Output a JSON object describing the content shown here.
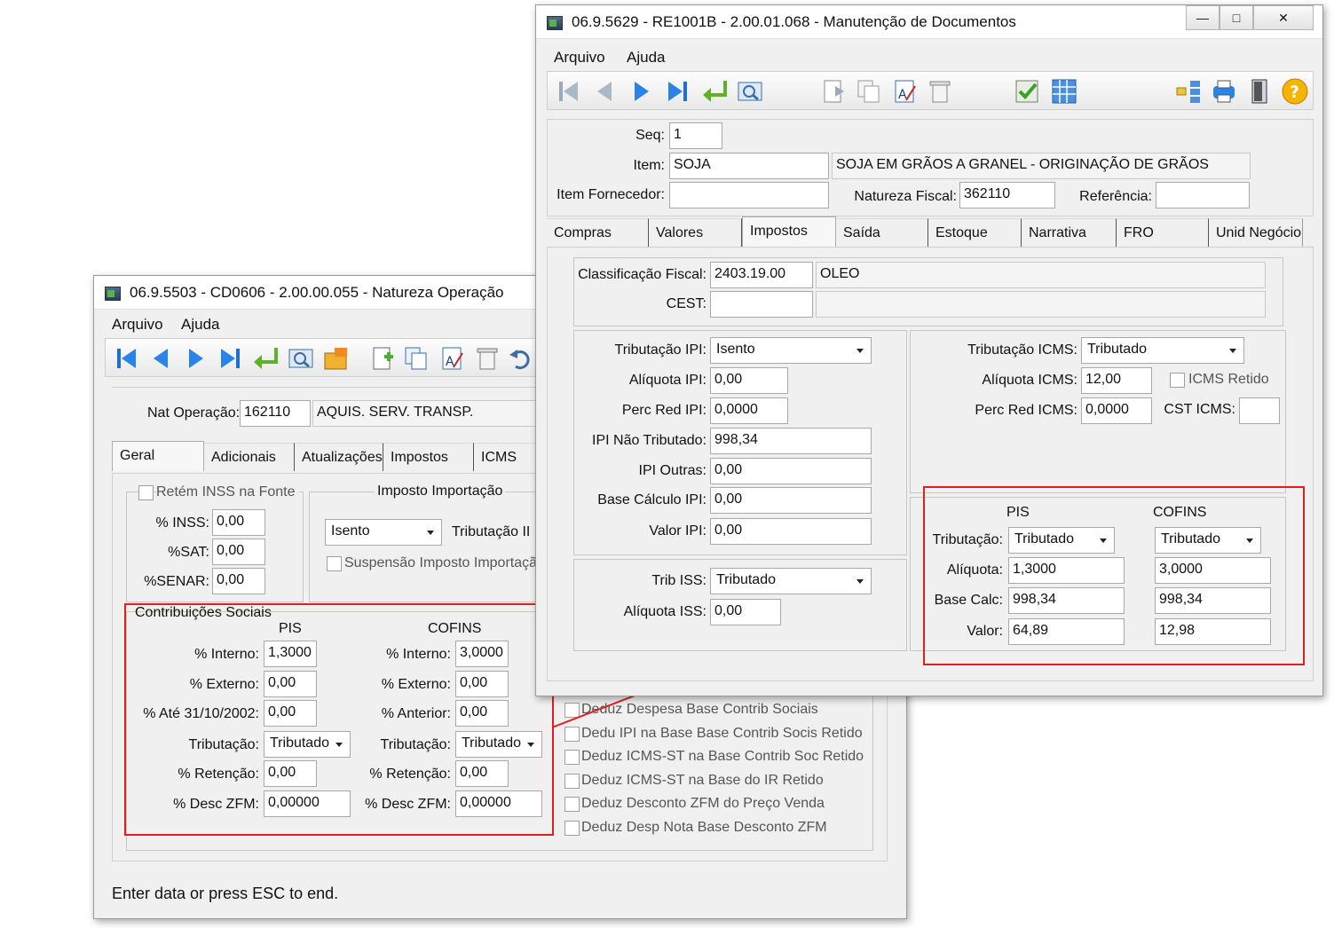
{
  "back_window": {
    "title": "06.9.5503 - CD0606 - 2.00.00.055 - Natureza Operação",
    "menu": [
      "Arquivo",
      "Ajuda"
    ],
    "nat_operacao": {
      "label": "Nat Operação:",
      "code": "162110",
      "desc": "AQUIS. SERV. TRANSP."
    },
    "tabs": [
      "Geral",
      "Adicionais",
      "Atualizações",
      "Impostos",
      "ICMS"
    ],
    "retem_inss": "Retém INSS na Fonte",
    "inss": {
      "label": "% INSS:",
      "value": "0,00"
    },
    "sat": {
      "label": "%SAT:",
      "value": "0,00"
    },
    "senar": {
      "label": "%SENAR:",
      "value": "0,00"
    },
    "imposto_importacao": {
      "title": "Imposto Importação",
      "combo": "Isento",
      "trib_label": "Tributação II",
      "suspensao": "Suspensão Imposto Importação"
    },
    "contrib": {
      "title": "Contribuições Sociais",
      "pis": {
        "header": "PIS",
        "interno_label": "% Interno:",
        "interno": "1,3000",
        "externo_label": "% Externo:",
        "externo": "0,00",
        "ate_label": "% Até 31/10/2002:",
        "ate": "0,00",
        "trib_label": "Tributação:",
        "trib": "Tributado",
        "ret_label": "% Retenção:",
        "ret": "0,00",
        "zfm_label": "% Desc ZFM:",
        "zfm": "0,00000"
      },
      "cofins": {
        "header": "COFINS",
        "interno_label": "% Interno:",
        "interno": "3,0000",
        "externo_label": "% Externo:",
        "externo": "0,00",
        "ant_label": "% Anterior:",
        "ant": "0,00",
        "trib_label": "Tributação:",
        "trib": "Tributado",
        "ret_label": "% Retenção:",
        "ret": "0,00",
        "zfm_label": "% Desc ZFM:",
        "zfm": "0,00000"
      }
    },
    "deduz": [
      "Deduz Despesa Base Contrib Sociais",
      "Dedu IPI na Base Base Contrib Socis Retido",
      "Deduz ICMS-ST na Base Contrib Soc Retido",
      "Deduz ICMS-ST na Base do IR Retido",
      "Deduz Desconto ZFM do Preço Venda",
      "Deduz Desp Nota Base Desconto ZFM"
    ],
    "status": "Enter data or press ESC to end."
  },
  "front_window": {
    "title": "06.9.5629 - RE1001B - 2.00.01.068 - Manutenção de Documentos",
    "menu": [
      "Arquivo",
      "Ajuda"
    ],
    "seq": {
      "label": "Seq:",
      "value": "1"
    },
    "item": {
      "label": "Item:",
      "code": "SOJA",
      "desc": "SOJA EM GRÃOS A GRANEL - ORIGINAÇÃO DE GRÃOS"
    },
    "item_fornecedor": {
      "label": "Item Fornecedor:",
      "value": ""
    },
    "natureza_fiscal": {
      "label": "Natureza Fiscal:",
      "value": "362110"
    },
    "referencia": {
      "label": "Referência:",
      "value": ""
    },
    "tabs": [
      "Compras",
      "Valores",
      "Impostos",
      "Saída",
      "Estoque",
      "Narrativa",
      "FRO",
      "Unid Negócio"
    ],
    "class_fiscal": {
      "label": "Classificação Fiscal:",
      "code": "2403.19.00",
      "desc": "OLEO"
    },
    "cest": {
      "label": "CEST:",
      "code": "",
      "desc": ""
    },
    "ipi": {
      "trib_label": "Tributação IPI:",
      "trib": "Isento",
      "aliq_label": "Alíquota IPI:",
      "aliq": "0,00",
      "red_label": "Perc Red IPI:",
      "red": "0,0000",
      "nao_trib_label": "IPI Não Tributado:",
      "nao_trib": "998,34",
      "outras_label": "IPI Outras:",
      "outras": "0,00",
      "base_label": "Base Cálculo IPI:",
      "base": "0,00",
      "valor_label": "Valor IPI:",
      "valor": "0,00"
    },
    "iss": {
      "trib_label": "Trib ISS:",
      "trib": "Tributado",
      "aliq_label": "Alíquota ISS:",
      "aliq": "0,00"
    },
    "icms": {
      "trib_label": "Tributação ICMS:",
      "trib": "Tributado",
      "aliq_label": "Alíquota ICMS:",
      "aliq": "12,00",
      "retido": "ICMS Retido",
      "red_label": "Perc Red ICMS:",
      "red": "0,0000",
      "cst_label": "CST ICMS:",
      "cst": ""
    },
    "pis_cofins": {
      "pis_header": "PIS",
      "cofins_header": "COFINS",
      "trib_label": "Tributação:",
      "pis_trib": "Tributado",
      "cofins_trib": "Tributado",
      "aliq_label": "Alíquota:",
      "pis_aliq": "1,3000",
      "cofins_aliq": "3,0000",
      "base_label": "Base Calc:",
      "pis_base": "998,34",
      "cofins_base": "998,34",
      "valor_label": "Valor:",
      "pis_valor": "64,89",
      "cofins_valor": "12,98"
    }
  },
  "colors": {
    "highlight": "#e02020",
    "window_bg": "#f0f0f0"
  }
}
